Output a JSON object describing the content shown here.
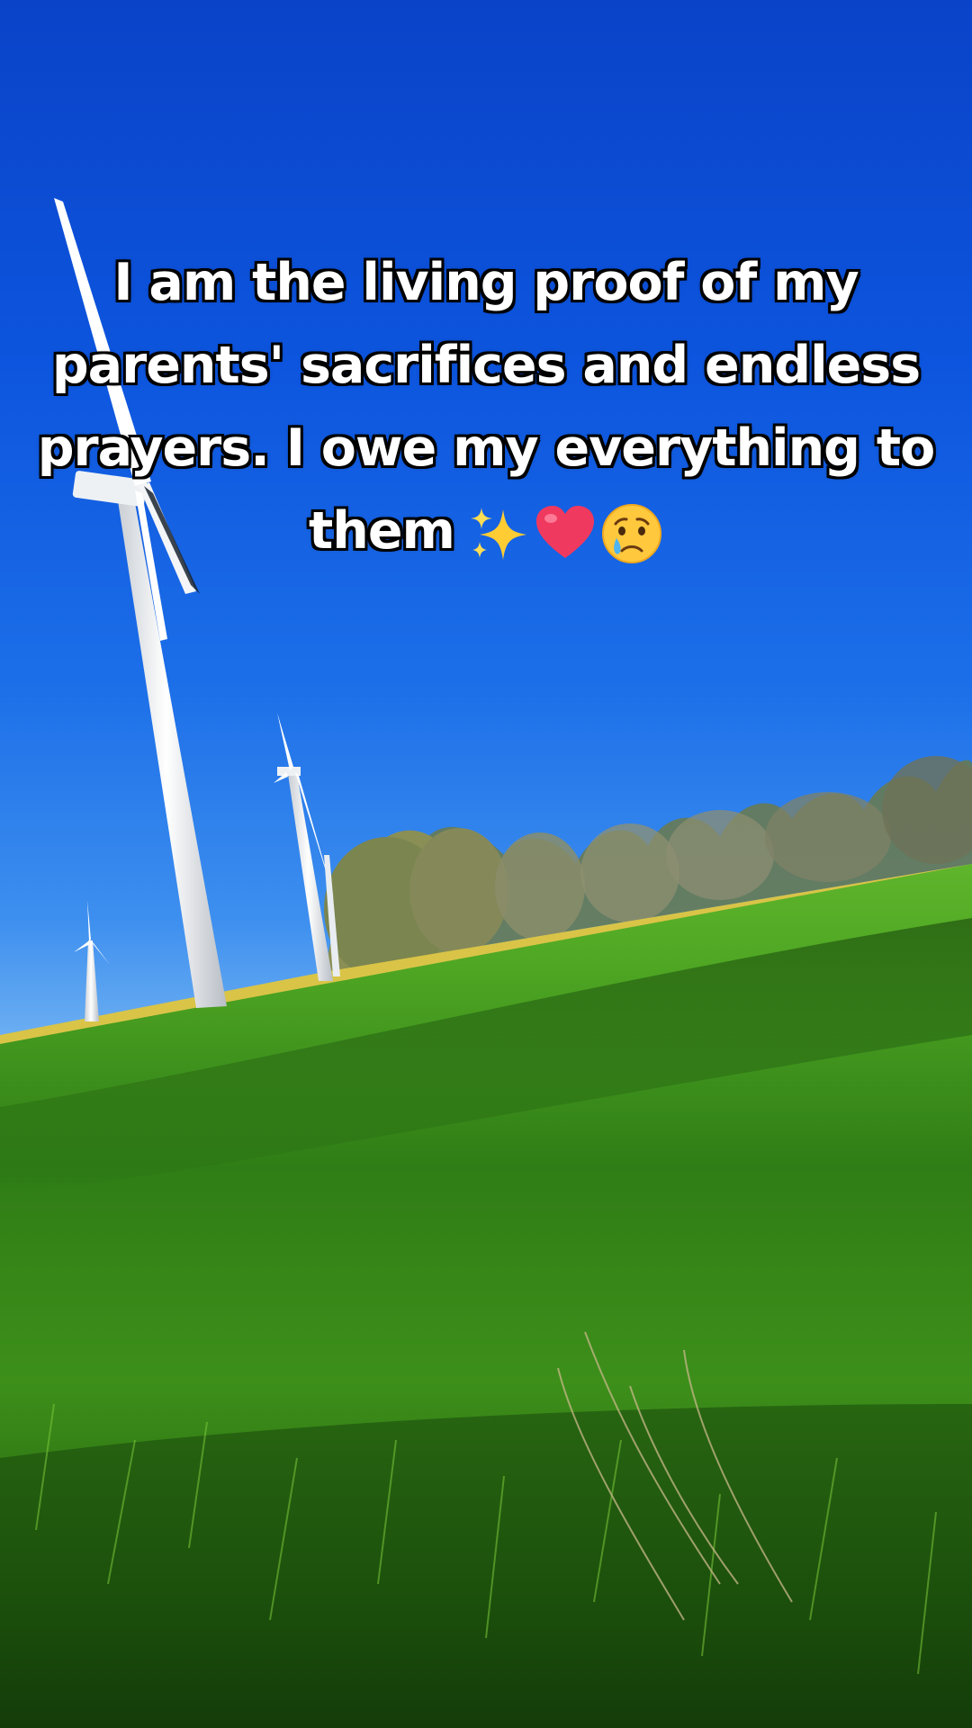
{
  "caption": {
    "line1": "I am the living proof of my",
    "line2": "parents' sacrifices and endless",
    "line3": "prayers. I owe my everything to",
    "line4": "them",
    "emojis": [
      "sparkles-icon",
      "red-heart-icon",
      "crying-face-icon"
    ]
  },
  "scene": {
    "sky_color": "#0d55de",
    "grass_color": "#3f9a1e",
    "turbine_color": "#f4f6f8"
  }
}
